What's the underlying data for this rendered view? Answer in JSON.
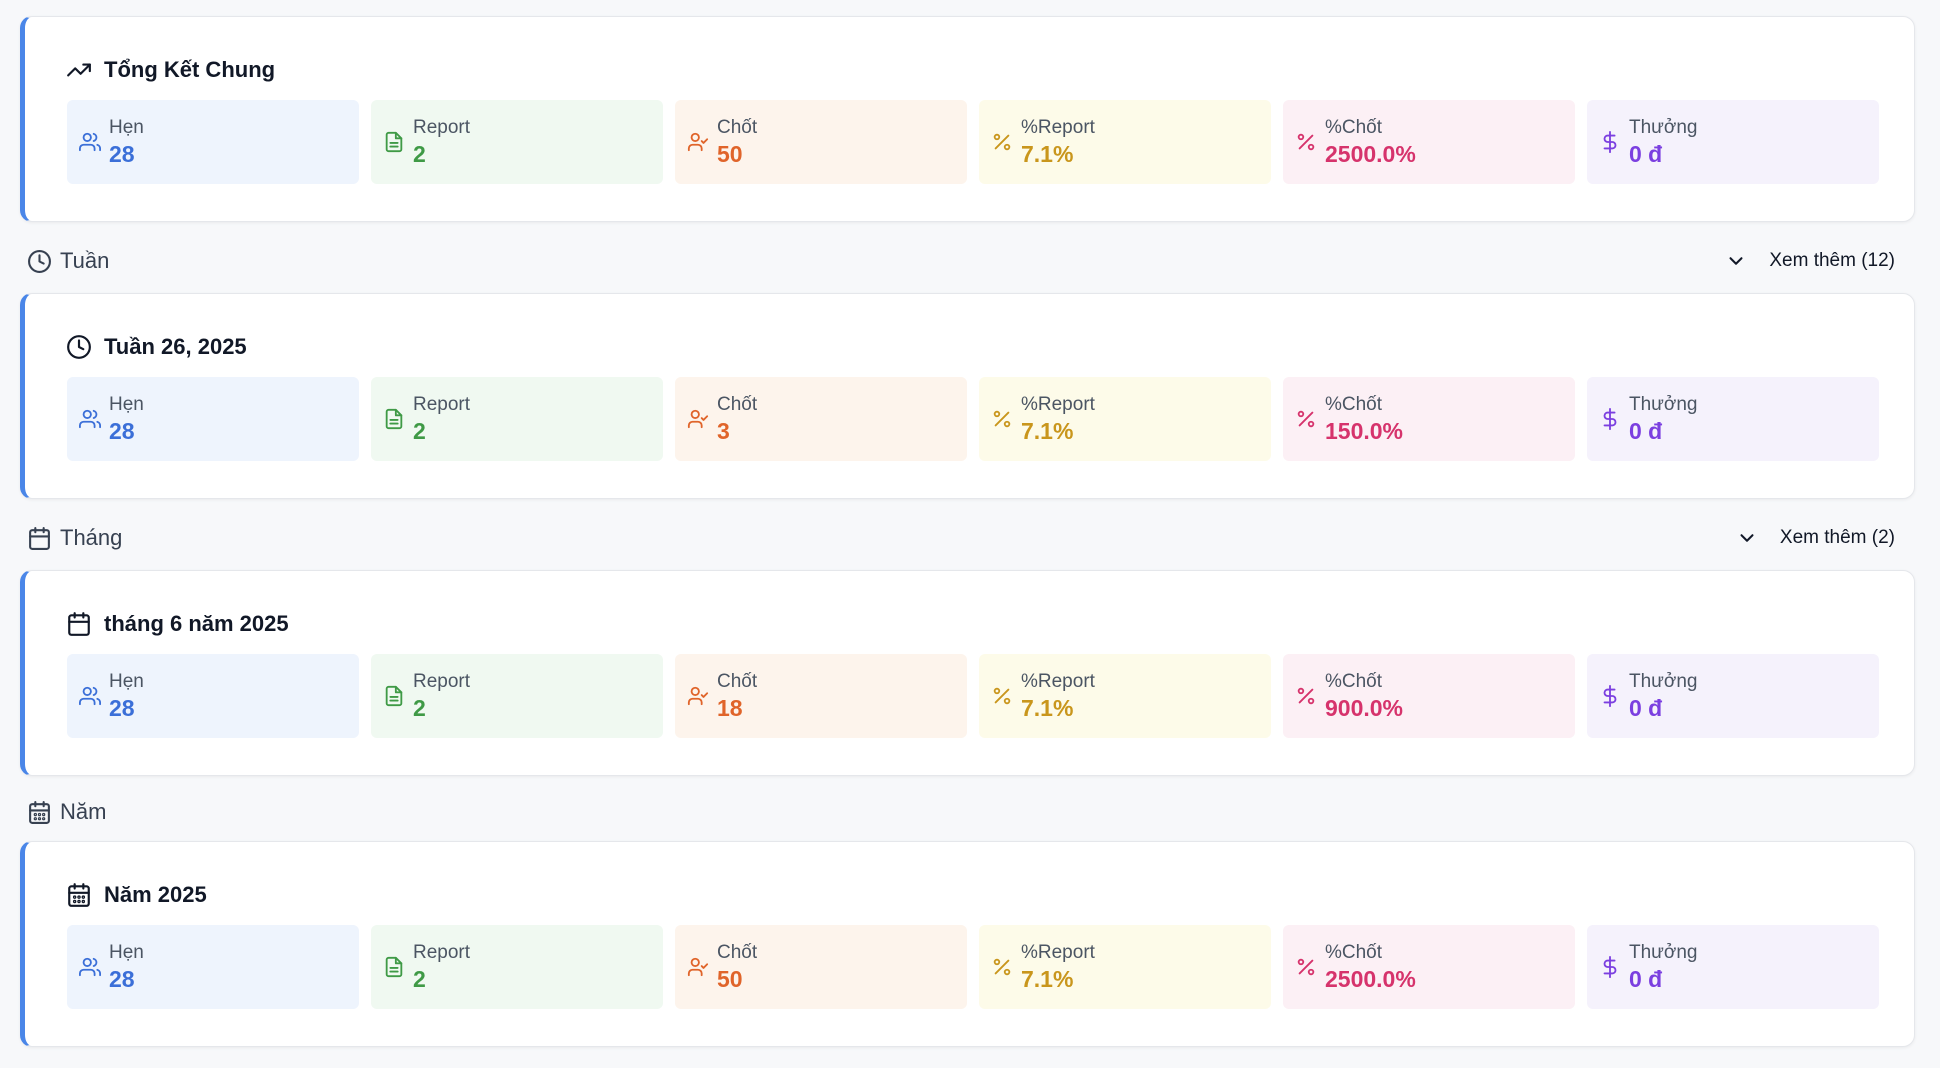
{
  "summary": {
    "title": "Tổng Kết Chung",
    "icon": "trending-up-icon",
    "stats": {
      "hen": {
        "label": "Hẹn",
        "value": "28"
      },
      "report": {
        "label": "Report",
        "value": "2"
      },
      "chot": {
        "label": "Chốt",
        "value": "50"
      },
      "pct_report": {
        "label": "%Report",
        "value": "7.1%"
      },
      "pct_chot": {
        "label": "%Chốt",
        "value": "2500.0%"
      },
      "thuong": {
        "label": "Thưởng",
        "value": "0 đ"
      }
    }
  },
  "week_section": {
    "label": "Tuần",
    "icon": "clock-icon",
    "more_label": "Xem thêm (12)",
    "card": {
      "title": "Tuần 26, 2025",
      "stats": {
        "hen": {
          "label": "Hẹn",
          "value": "28"
        },
        "report": {
          "label": "Report",
          "value": "2"
        },
        "chot": {
          "label": "Chốt",
          "value": "3"
        },
        "pct_report": {
          "label": "%Report",
          "value": "7.1%"
        },
        "pct_chot": {
          "label": "%Chốt",
          "value": "150.0%"
        },
        "thuong": {
          "label": "Thưởng",
          "value": "0 đ"
        }
      }
    }
  },
  "month_section": {
    "label": "Tháng",
    "icon": "calendar-icon",
    "more_label": "Xem thêm (2)",
    "card": {
      "title": "tháng 6 năm 2025",
      "stats": {
        "hen": {
          "label": "Hẹn",
          "value": "28"
        },
        "report": {
          "label": "Report",
          "value": "2"
        },
        "chot": {
          "label": "Chốt",
          "value": "18"
        },
        "pct_report": {
          "label": "%Report",
          "value": "7.1%"
        },
        "pct_chot": {
          "label": "%Chốt",
          "value": "900.0%"
        },
        "thuong": {
          "label": "Thưởng",
          "value": "0 đ"
        }
      }
    }
  },
  "year_section": {
    "label": "Năm",
    "icon": "calendar-days-icon",
    "card": {
      "title": "Năm 2025",
      "stats": {
        "hen": {
          "label": "Hẹn",
          "value": "28"
        },
        "report": {
          "label": "Report",
          "value": "2"
        },
        "chot": {
          "label": "Chốt",
          "value": "50"
        },
        "pct_report": {
          "label": "%Report",
          "value": "7.1%"
        },
        "pct_chot": {
          "label": "%Chốt",
          "value": "2500.0%"
        },
        "thuong": {
          "label": "Thưởng",
          "value": "0 đ"
        }
      }
    }
  },
  "colors": {
    "accent": "#4a86e8",
    "blue": "#3b6fd8",
    "green": "#3f9a46",
    "orange": "#e0642a",
    "yellow": "#c9961c",
    "pink": "#d6336c",
    "purple": "#7b3fe0"
  }
}
